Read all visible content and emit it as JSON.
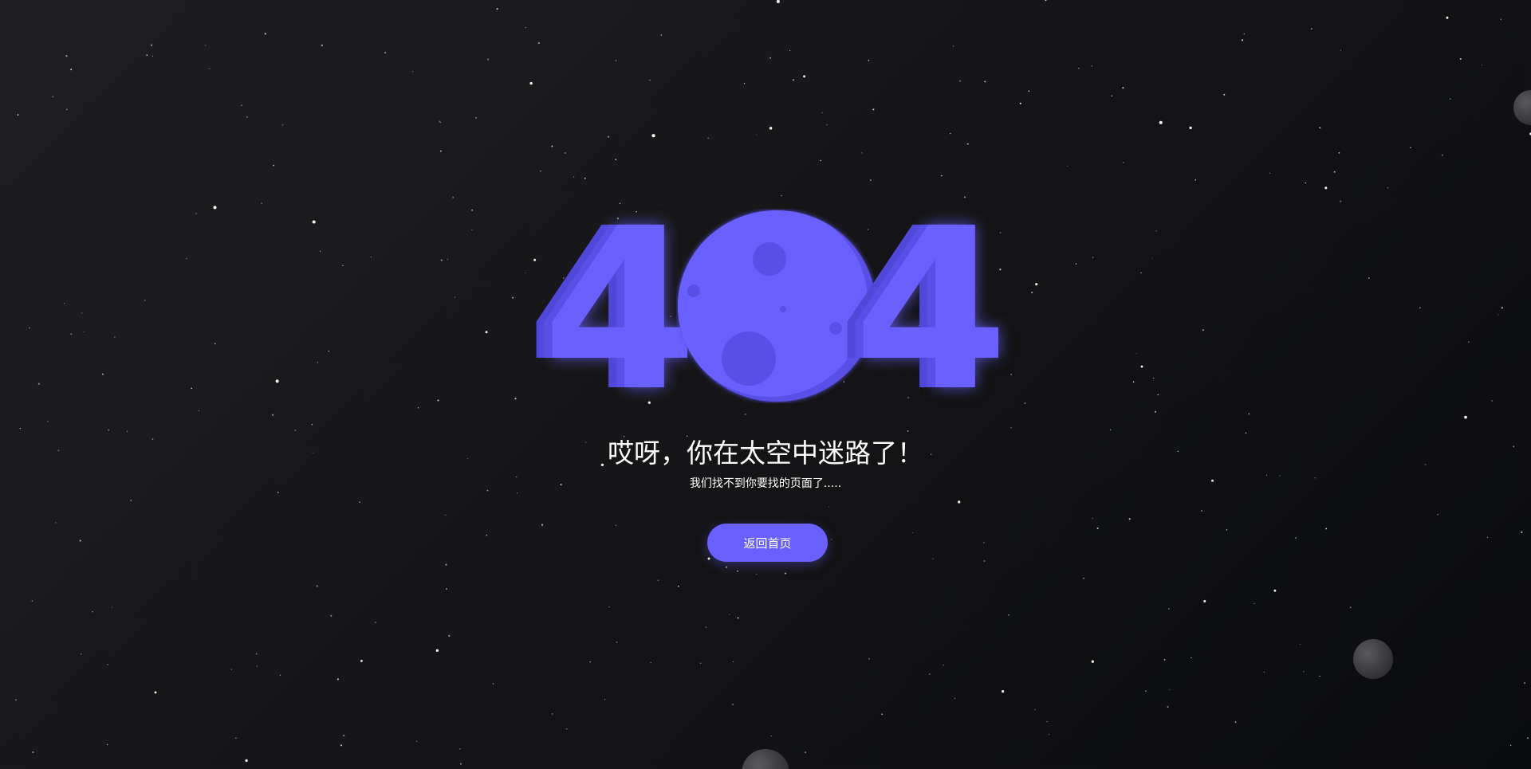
{
  "error_code": {
    "first_digit": "4",
    "last_digit": "4"
  },
  "message": {
    "title": "哎呀，你在太空中迷路了！",
    "subtitle": "我们找不到你要找的页面了....."
  },
  "actions": {
    "home_button_label": "返回首页"
  },
  "colors": {
    "accent": "#6a60fe",
    "accent_dark": "#5850e6",
    "background_light": "#1f1f21",
    "background_dark": "#0a0b0e"
  }
}
